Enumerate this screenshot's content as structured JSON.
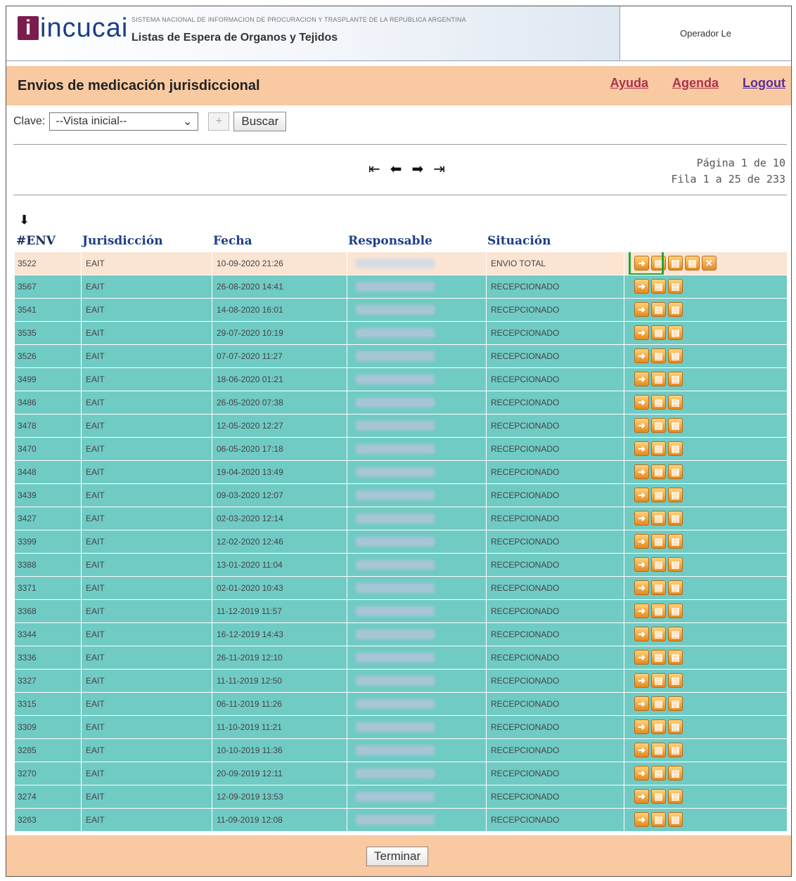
{
  "header": {
    "logo_text": "incucai",
    "subtitle": "SISTEMA NACIONAL DE INFORMACION DE PROCURACION Y TRASPLANTE DE LA REPUBLICA ARGENTINA",
    "app_title": "Listas de Espera de Organos y Tejidos",
    "operator": "Operador Le"
  },
  "titlebar": {
    "page_title": "Envios de medicación jurisdiccional",
    "links": {
      "help": "Ayuda",
      "agenda": "Agenda",
      "logout": "Logout"
    }
  },
  "filter": {
    "label": "Clave:",
    "select_value": "--Vista inicial--",
    "plus_label": "+",
    "search_label": "Buscar"
  },
  "pager": {
    "first_glyph": "⇤",
    "prev_glyph": "⬅",
    "next_glyph": "➡",
    "last_glyph": "⇥",
    "page_text": "Página 1 de 10",
    "rows_text": "Fila 1 a 25 de 233"
  },
  "table": {
    "sort_glyph": "⬇",
    "columns": {
      "env": "#ENV",
      "jur": "Jurisdicción",
      "fecha": "Fecha",
      "resp": "Responsable",
      "sit": "Situación"
    },
    "rows": [
      {
        "env": "3522",
        "jur": "EAIT",
        "fecha": "10-09-2020 21:26",
        "sit": "ENVIO TOTAL"
      },
      {
        "env": "3567",
        "jur": "EAIT",
        "fecha": "26-08-2020 14:41",
        "sit": "RECEPCIONADO"
      },
      {
        "env": "3541",
        "jur": "EAIT",
        "fecha": "14-08-2020 16:01",
        "sit": "RECEPCIONADO"
      },
      {
        "env": "3535",
        "jur": "EAIT",
        "fecha": "29-07-2020 10:19",
        "sit": "RECEPCIONADO"
      },
      {
        "env": "3526",
        "jur": "EAIT",
        "fecha": "07-07-2020 11:27",
        "sit": "RECEPCIONADO"
      },
      {
        "env": "3499",
        "jur": "EAIT",
        "fecha": "18-06-2020 01:21",
        "sit": "RECEPCIONADO"
      },
      {
        "env": "3486",
        "jur": "EAIT",
        "fecha": "26-05-2020 07:38",
        "sit": "RECEPCIONADO"
      },
      {
        "env": "3478",
        "jur": "EAIT",
        "fecha": "12-05-2020 12:27",
        "sit": "RECEPCIONADO"
      },
      {
        "env": "3470",
        "jur": "EAIT",
        "fecha": "06-05-2020 17:18",
        "sit": "RECEPCIONADO"
      },
      {
        "env": "3448",
        "jur": "EAIT",
        "fecha": "19-04-2020 13:49",
        "sit": "RECEPCIONADO"
      },
      {
        "env": "3439",
        "jur": "EAIT",
        "fecha": "09-03-2020 12:07",
        "sit": "RECEPCIONADO"
      },
      {
        "env": "3427",
        "jur": "EAIT",
        "fecha": "02-03-2020 12:14",
        "sit": "RECEPCIONADO"
      },
      {
        "env": "3399",
        "jur": "EAIT",
        "fecha": "12-02-2020 12:46",
        "sit": "RECEPCIONADO"
      },
      {
        "env": "3388",
        "jur": "EAIT",
        "fecha": "13-01-2020 11:04",
        "sit": "RECEPCIONADO"
      },
      {
        "env": "3371",
        "jur": "EAIT",
        "fecha": "02-01-2020 10:43",
        "sit": "RECEPCIONADO"
      },
      {
        "env": "3368",
        "jur": "EAIT",
        "fecha": "11-12-2019 11:57",
        "sit": "RECEPCIONADO"
      },
      {
        "env": "3344",
        "jur": "EAIT",
        "fecha": "16-12-2019 14:43",
        "sit": "RECEPCIONADO"
      },
      {
        "env": "3336",
        "jur": "EAIT",
        "fecha": "26-11-2019 12:10",
        "sit": "RECEPCIONADO"
      },
      {
        "env": "3327",
        "jur": "EAIT",
        "fecha": "11-11-2019 12:50",
        "sit": "RECEPCIONADO"
      },
      {
        "env": "3315",
        "jur": "EAIT",
        "fecha": "06-11-2019 11:26",
        "sit": "RECEPCIONADO"
      },
      {
        "env": "3309",
        "jur": "EAIT",
        "fecha": "11-10-2019 11:21",
        "sit": "RECEPCIONADO"
      },
      {
        "env": "3285",
        "jur": "EAIT",
        "fecha": "10-10-2019 11:36",
        "sit": "RECEPCIONADO"
      },
      {
        "env": "3270",
        "jur": "EAIT",
        "fecha": "20-09-2019 12:11",
        "sit": "RECEPCIONADO"
      },
      {
        "env": "3274",
        "jur": "EAIT",
        "fecha": "12-09-2019 13:53",
        "sit": "RECEPCIONADO"
      },
      {
        "env": "3263",
        "jur": "EAIT",
        "fecha": "11-09-2019 12:08",
        "sit": "RECEPCIONADO"
      }
    ]
  },
  "footer": {
    "finish_label": "Terminar"
  },
  "colors": {
    "peach": "#f9c9a1",
    "teal_row": "#70cbc4",
    "highlight": "#1ca83a"
  }
}
